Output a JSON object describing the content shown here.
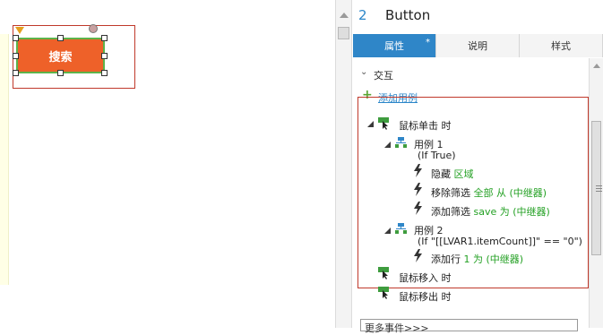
{
  "canvas": {
    "widget_label": "搜索"
  },
  "panel": {
    "widget_number": "2",
    "widget_name": "Button",
    "tabs": [
      {
        "label": "属性",
        "marker": "*"
      },
      {
        "label": "说明"
      },
      {
        "label": "样式"
      }
    ],
    "interactions_heading": "交互",
    "add_case_link": "添加用例",
    "events": [
      {
        "name": "鼠标单击 时",
        "cases": [
          {
            "title": "用例 1",
            "condition": "(If True)",
            "actions": [
              {
                "verb": "隐藏",
                "detail": "区域"
              },
              {
                "verb": "移除筛选",
                "detail": "全部 从 (中继器)"
              },
              {
                "verb": "添加筛选",
                "detail": "save 为 (中继器)"
              }
            ]
          },
          {
            "title": "用例 2",
            "condition": "(If \"[[LVAR1.itemCount]]\" == \"0\")",
            "actions": [
              {
                "verb": "添加行",
                "detail": "1 为 (中继器)"
              }
            ]
          }
        ]
      },
      {
        "name": "鼠标移入 时"
      },
      {
        "name": "鼠标移出 时"
      }
    ],
    "more_events": "更多事件>>>"
  },
  "colors": {
    "accent": "#2f86c8",
    "button_fill": "#ee6129",
    "action_detail": "#23a023",
    "selection_frame": "#c0392b"
  }
}
